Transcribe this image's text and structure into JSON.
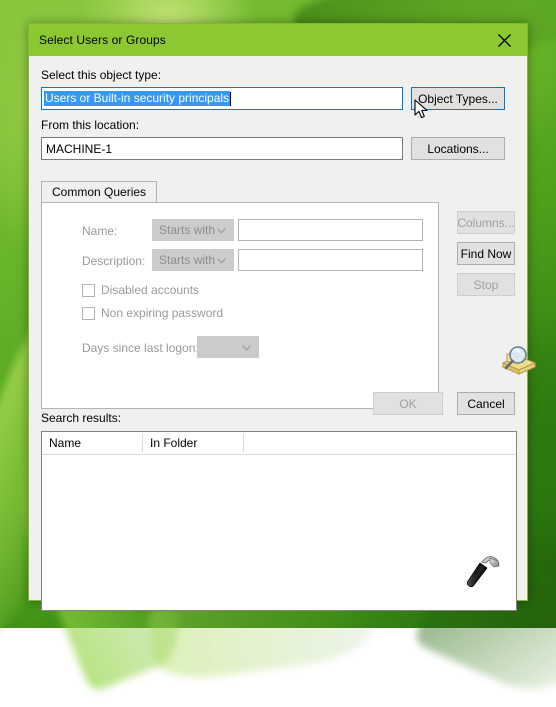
{
  "window": {
    "title": "Select Users or Groups",
    "close_icon": "close-icon",
    "titlebar_color": "#8bc832"
  },
  "object_type": {
    "label": "Select this object type:",
    "value": "Users or Built-in security principals",
    "button_label": "Object Types..."
  },
  "location": {
    "label": "From this location:",
    "value": "MACHINE-1",
    "button_label": "Locations..."
  },
  "tabs": [
    {
      "label": "Common Queries",
      "selected": true
    }
  ],
  "query": {
    "name_label": "Name:",
    "name_operator": "Starts with",
    "name_value": "",
    "description_label": "Description:",
    "description_operator": "Starts with",
    "description_value": "",
    "disabled_accounts_label": "Disabled accounts",
    "disabled_accounts_checked": false,
    "non_expiring_label": "Non expiring password",
    "non_expiring_checked": false,
    "days_label": "Days since last logon:",
    "days_value": ""
  },
  "side_buttons": {
    "columns_label": "Columns...",
    "columns_enabled": false,
    "find_now_label": "Find Now",
    "find_now_enabled": true,
    "stop_label": "Stop",
    "stop_enabled": false,
    "find_icon": "magnifier-folder-icon"
  },
  "footer": {
    "ok_label": "OK",
    "ok_enabled": false,
    "cancel_label": "Cancel",
    "cancel_enabled": true
  },
  "results": {
    "label": "Search results:",
    "columns": [
      "Name",
      "In Folder",
      ""
    ],
    "rows": []
  },
  "decoration": {
    "hammer_icon": "hammer-icon",
    "cursor_icon": "arrow-cursor-icon"
  }
}
